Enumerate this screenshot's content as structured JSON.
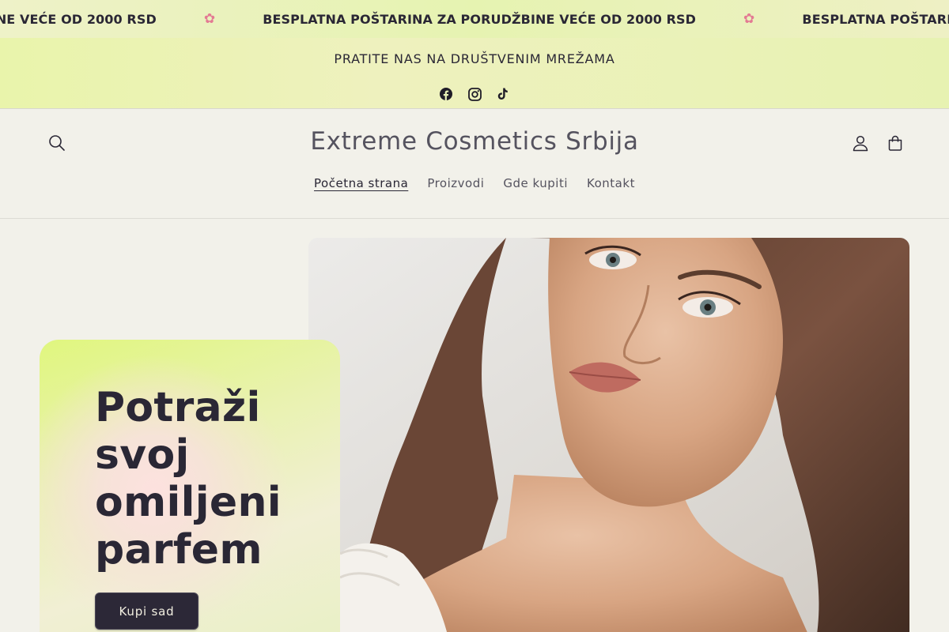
{
  "marquee": {
    "message": "BESPLATNA POŠTARINA ZA PORUDŽBINE VEĆE OD 2000 RSD",
    "separator_icon": "flower-icon",
    "colors": {
      "flower": "#e37a93"
    }
  },
  "announcement": {
    "text": "PRATITE NAS NA DRUŠTVENIM MREŽAMA",
    "social": [
      "facebook-icon",
      "instagram-icon",
      "tiktok-icon"
    ]
  },
  "header": {
    "brand": "Extreme Cosmetics Srbija",
    "icons": {
      "search": "search-icon",
      "account": "account-icon",
      "cart": "cart-icon"
    },
    "nav": [
      {
        "label": "Početna strana",
        "active": true
      },
      {
        "label": "Proizvodi",
        "active": false
      },
      {
        "label": "Gde kupiti",
        "active": false
      },
      {
        "label": "Kontakt",
        "active": false
      }
    ]
  },
  "hero": {
    "title": "Potraži svoj omiljeni parfem",
    "cta_label": "Kupi sad",
    "colors": {
      "cta_bg": "#2c2837",
      "card_accent": "#e0f67e"
    }
  }
}
